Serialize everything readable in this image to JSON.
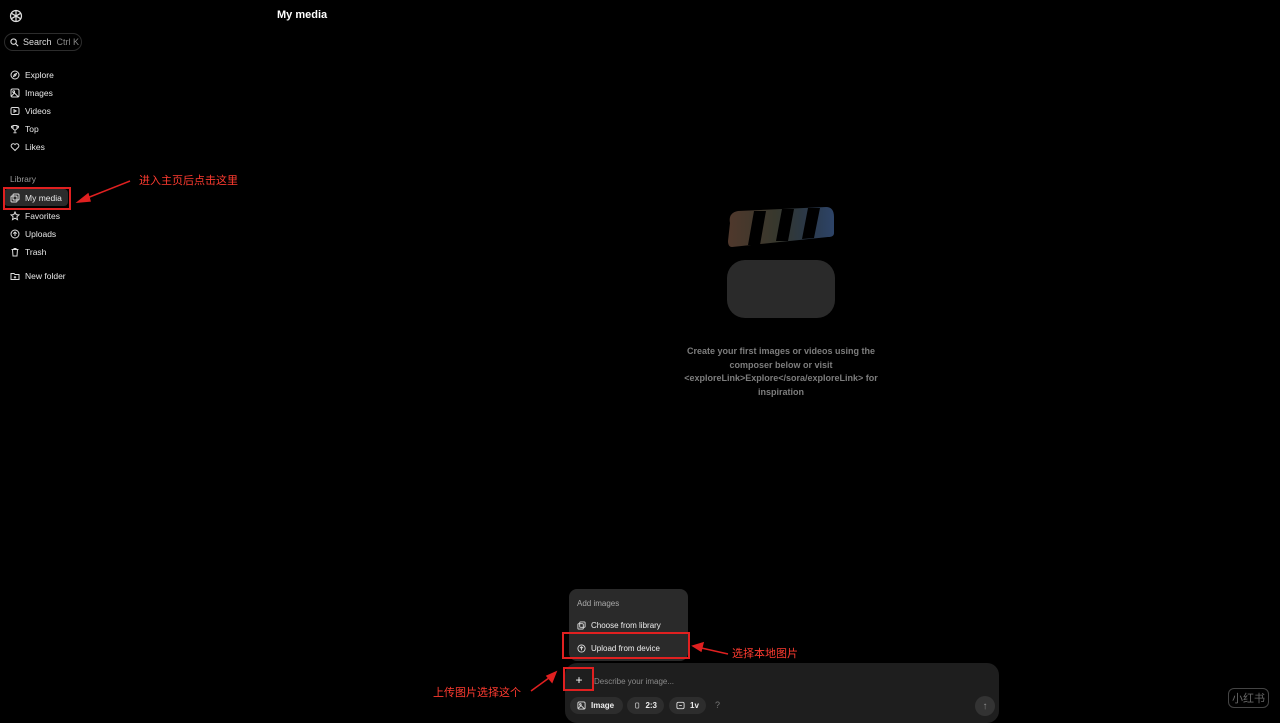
{
  "page_title": "My media",
  "search": {
    "label": "Search",
    "shortcut": "Ctrl K"
  },
  "nav": {
    "explore": "Explore",
    "images": "Images",
    "videos": "Videos",
    "top": "Top",
    "likes": "Likes"
  },
  "library": {
    "label": "Library",
    "my_media": "My media",
    "favorites": "Favorites",
    "uploads": "Uploads",
    "trash": "Trash",
    "new_folder": "New folder"
  },
  "empty_state": {
    "text": "Create your first images or videos using the composer below or visit <exploreLink>Explore</sora/exploreLink> for inspiration"
  },
  "add_menu": {
    "title": "Add images",
    "choose_library": "Choose from library",
    "upload_device": "Upload from device"
  },
  "composer": {
    "plus": "+",
    "placeholder": "Describe your image...",
    "type_chip": "Image",
    "ratio_chip": "2:3",
    "count_chip": "1v",
    "help": "?",
    "send": "↑"
  },
  "annotations": {
    "my_media_hint": "进入主页后点击这里",
    "upload_hint": "选择本地图片",
    "plus_hint": "上传图片选择这个"
  },
  "watermark": "小红书",
  "colors": {
    "background": "#000000",
    "annotation": "#e02020",
    "composer": "#1e1e1e"
  }
}
